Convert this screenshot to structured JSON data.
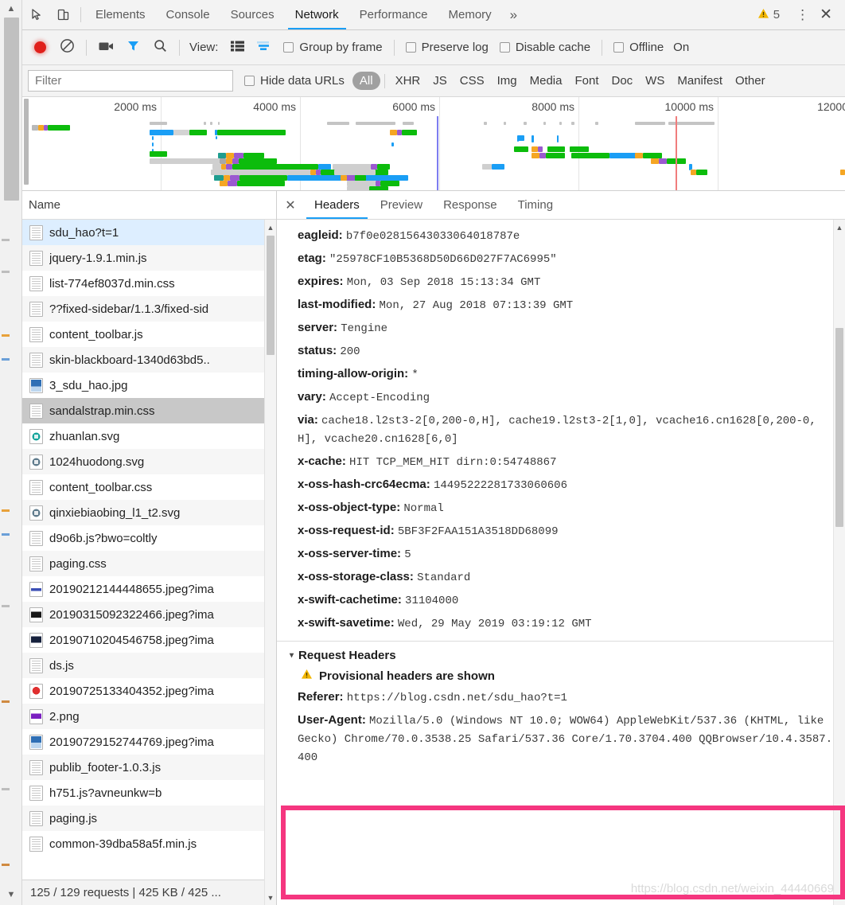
{
  "window": {
    "tabs": [
      {
        "label": "Elements",
        "active": false
      },
      {
        "label": "Console",
        "active": false
      },
      {
        "label": "Sources",
        "active": false
      },
      {
        "label": "Network",
        "active": true
      },
      {
        "label": "Performance",
        "active": false
      },
      {
        "label": "Memory",
        "active": false
      }
    ],
    "more_label": "»",
    "warning_count": "5",
    "warning_icon": "warning-triangle-icon",
    "kebab_label": "⋮",
    "close_label": "✕",
    "inspect_icon": "inspect-cursor-icon",
    "device_icon": "device-toolbar-icon"
  },
  "toolbar": {
    "record_icon": "record-circle-icon",
    "clear_icon": "clear-no-entry-icon",
    "screenshot_icon": "camera-icon",
    "filter_icon": "funnel-icon",
    "search_icon": "magnifier-icon",
    "view_label": "View:",
    "list_view_icon": "list-view-icon",
    "waterfall_view_icon": "waterfall-view-icon",
    "checkboxes": [
      {
        "label": "Group by frame",
        "checked": false
      },
      {
        "label": "Preserve log",
        "checked": false
      },
      {
        "label": "Disable cache",
        "checked": false
      },
      {
        "label": "Offline",
        "checked": false
      }
    ],
    "truncated_label": "On"
  },
  "filterbar": {
    "placeholder": "Filter",
    "value": "",
    "hide_data_urls_label": "Hide data URLs",
    "hide_data_urls_checked": false,
    "types": [
      {
        "label": "All",
        "selected": true
      },
      {
        "label": "XHR",
        "selected": false
      },
      {
        "label": "JS",
        "selected": false
      },
      {
        "label": "CSS",
        "selected": false
      },
      {
        "label": "Img",
        "selected": false
      },
      {
        "label": "Media",
        "selected": false
      },
      {
        "label": "Font",
        "selected": false
      },
      {
        "label": "Doc",
        "selected": false
      },
      {
        "label": "WS",
        "selected": false
      },
      {
        "label": "Manifest",
        "selected": false
      },
      {
        "label": "Other",
        "selected": false
      }
    ]
  },
  "overview": {
    "ticks": [
      "2000 ms",
      "4000 ms",
      "6000 ms",
      "8000 ms",
      "10000 ms",
      "12000"
    ],
    "dom_content_loaded_color": "#7d7df0",
    "load_event_color": "#f07d7d"
  },
  "requests": {
    "column_header": "Name",
    "items": [
      {
        "name": "sdu_hao?t=1",
        "icon": "document-icon",
        "state": "selected-blue"
      },
      {
        "name": "jquery-1.9.1.min.js",
        "icon": "document-icon",
        "state": ""
      },
      {
        "name": "list-774ef8037d.min.css",
        "icon": "document-icon",
        "state": ""
      },
      {
        "name": "??fixed-sidebar/1.1.3/fixed-sid",
        "icon": "document-icon",
        "state": ""
      },
      {
        "name": "content_toolbar.js",
        "icon": "document-icon",
        "state": ""
      },
      {
        "name": "skin-blackboard-1340d63bd5..",
        "icon": "document-icon",
        "state": ""
      },
      {
        "name": "3_sdu_hao.jpg",
        "icon": "image-icon",
        "state": ""
      },
      {
        "name": "sandalstrap.min.css",
        "icon": "document-icon",
        "state": "selected-gray"
      },
      {
        "name": "zhuanlan.svg",
        "icon": "svg-icon",
        "state": ""
      },
      {
        "name": "1024huodong.svg",
        "icon": "svg-icon",
        "state": ""
      },
      {
        "name": "content_toolbar.css",
        "icon": "document-icon",
        "state": ""
      },
      {
        "name": "qinxiebiaobing_l1_t2.svg",
        "icon": "svg-icon",
        "state": ""
      },
      {
        "name": "d9o6b.js?bwo=coltly",
        "icon": "document-icon",
        "state": ""
      },
      {
        "name": "paging.css",
        "icon": "document-icon",
        "state": ""
      },
      {
        "name": "20190212144448655.jpeg?ima",
        "icon": "image-icon",
        "state": ""
      },
      {
        "name": "20190315092322466.jpeg?ima",
        "icon": "image-icon",
        "state": ""
      },
      {
        "name": "20190710204546758.jpeg?ima",
        "icon": "image-icon",
        "state": ""
      },
      {
        "name": "ds.js",
        "icon": "document-icon",
        "state": ""
      },
      {
        "name": "20190725133404352.jpeg?ima",
        "icon": "image-icon",
        "state": ""
      },
      {
        "name": "2.png",
        "icon": "image-icon",
        "state": ""
      },
      {
        "name": "20190729152744769.jpeg?ima",
        "icon": "image-icon",
        "state": ""
      },
      {
        "name": "publib_footer-1.0.3.js",
        "icon": "document-icon",
        "state": ""
      },
      {
        "name": "h751.js?avneunkw=b",
        "icon": "document-icon",
        "state": ""
      },
      {
        "name": "paging.js",
        "icon": "document-icon",
        "state": ""
      },
      {
        "name": "common-39dba58a5f.min.js",
        "icon": "document-icon",
        "state": ""
      }
    ]
  },
  "status": {
    "text": "125 / 129 requests  |  425 KB / 425 ..."
  },
  "details": {
    "close_label": "✕",
    "tabs": [
      {
        "label": "Headers",
        "active": true
      },
      {
        "label": "Preview",
        "active": false
      },
      {
        "label": "Response",
        "active": false
      },
      {
        "label": "Timing",
        "active": false
      }
    ],
    "response_headers": [
      {
        "name": "eagleid:",
        "value": "b7f0e02815643033064018787e"
      },
      {
        "name": "etag:",
        "value": "\"25978CF10B5368D50D66D027F7AC6995\""
      },
      {
        "name": "expires:",
        "value": "Mon, 03 Sep 2018 15:13:34 GMT"
      },
      {
        "name": "last-modified:",
        "value": "Mon, 27 Aug 2018 07:13:39 GMT"
      },
      {
        "name": "server:",
        "value": "Tengine"
      },
      {
        "name": "status:",
        "value": "200"
      },
      {
        "name": "timing-allow-origin:",
        "value": "*"
      },
      {
        "name": "vary:",
        "value": "Accept-Encoding"
      },
      {
        "name": "via:",
        "value": "cache18.l2st3-2[0,200-0,H], cache19.l2st3-2[1,0], vcache16.cn1628[0,200-0,H], vcache20.cn1628[6,0]"
      },
      {
        "name": "x-cache:",
        "value": "HIT TCP_MEM_HIT dirn:0:54748867"
      },
      {
        "name": "x-oss-hash-crc64ecma:",
        "value": "14495222281733060606"
      },
      {
        "name": "x-oss-object-type:",
        "value": "Normal"
      },
      {
        "name": "x-oss-request-id:",
        "value": "5BF3F2FAA151A3518DD68099"
      },
      {
        "name": "x-oss-server-time:",
        "value": "5"
      },
      {
        "name": "x-oss-storage-class:",
        "value": "Standard"
      },
      {
        "name": "x-swift-cachetime:",
        "value": "31104000"
      },
      {
        "name": "x-swift-savetime:",
        "value": "Wed, 29 May 2019 03:19:12 GMT"
      }
    ],
    "request_headers_section": {
      "caret": "▾",
      "title": "Request Headers",
      "warning_icon": "warning-triangle-icon",
      "provisional_text": "Provisional headers are shown",
      "items": [
        {
          "name": "Referer:",
          "value": "https://blog.csdn.net/sdu_hao?t=1"
        },
        {
          "name": "User-Agent:",
          "value": "Mozilla/5.0 (Windows NT 10.0; WOW64) AppleWebKit/537.36 (KHTML, like Gecko) Chrome/70.0.3538.25 Safari/537.36 Core/1.70.3704.400 QQBrowser/10.4.3587.400"
        }
      ]
    }
  },
  "annotation": {
    "highlight_color": "#f5367f",
    "watermark": "https://blog.csdn.net/weixin_44440669"
  }
}
